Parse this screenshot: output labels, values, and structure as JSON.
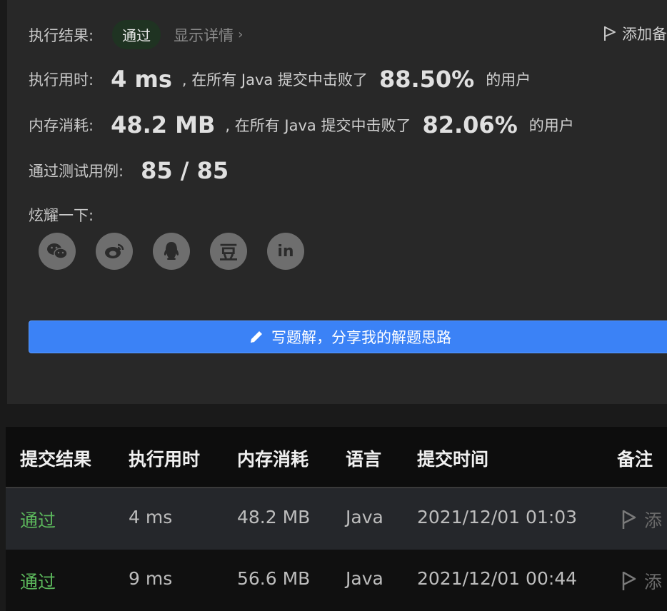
{
  "result": {
    "label": "执行结果:",
    "status": "通过",
    "details_link": "显示详情",
    "add_note": "添加备"
  },
  "runtime": {
    "label": "执行用时:",
    "value": "4 ms",
    "prefix": ", 在所有 Java 提交中击败了",
    "percent": "88.50%",
    "suffix": "的用户"
  },
  "memory": {
    "label": "内存消耗:",
    "value": "48.2 MB",
    "prefix": ", 在所有 Java 提交中击败了",
    "percent": "82.06%",
    "suffix": "的用户"
  },
  "tests": {
    "label": "通过测试用例:",
    "value": "85 / 85"
  },
  "share": {
    "label": "炫耀一下:",
    "icons": [
      "wechat-icon",
      "weibo-icon",
      "qq-icon",
      "douban-icon",
      "linkedin-icon"
    ],
    "douban_glyph": "豆",
    "linkedin_glyph": "in"
  },
  "solution_button": "写题解，分享我的解题思路",
  "table": {
    "headers": [
      "提交结果",
      "执行用时",
      "内存消耗",
      "语言",
      "提交时间",
      "备注"
    ],
    "rows": [
      [
        "通过",
        "4 ms",
        "48.2 MB",
        "Java",
        "2021/12/01 01:03",
        "添"
      ],
      [
        "通过",
        "9 ms",
        "56.6 MB",
        "Java",
        "2021/12/01 00:44",
        "添"
      ]
    ]
  },
  "colors": {
    "accent": "#3b82f6",
    "success": "#5cb85c",
    "badge_bg": "#1f3322"
  }
}
